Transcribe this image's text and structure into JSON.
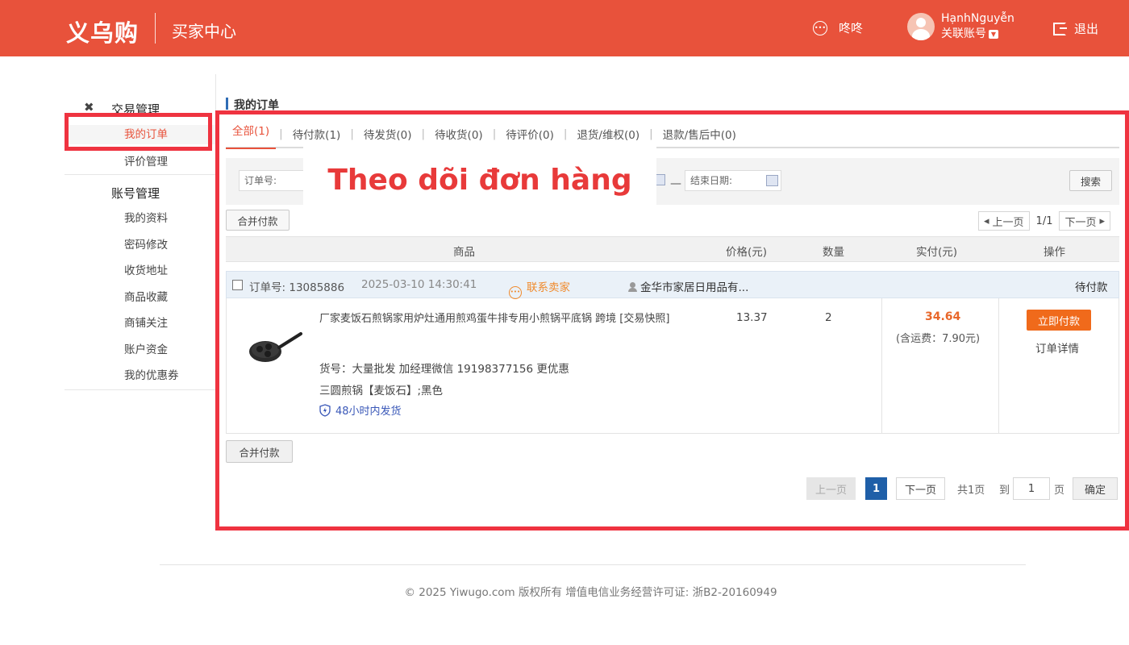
{
  "header": {
    "logo": "义乌购",
    "subtitle": "买家中心",
    "chat_label": "咚咚",
    "user_name": "HạnhNguyễn",
    "linked_account": "关联账号",
    "logout_label": "退出"
  },
  "sidebar": {
    "group_trade": "交易管理",
    "items_trade": [
      {
        "label": "我的订单"
      },
      {
        "label": "评价管理"
      }
    ],
    "group_account": "账号管理",
    "items_account": [
      {
        "label": "我的资料"
      },
      {
        "label": "密码修改"
      },
      {
        "label": "收货地址"
      },
      {
        "label": "商品收藏"
      },
      {
        "label": "商铺关注"
      },
      {
        "label": "账户资金"
      },
      {
        "label": "我的优惠券"
      }
    ]
  },
  "main": {
    "title": "我的订单",
    "tabs": [
      {
        "label": "全部(1)"
      },
      {
        "label": "待付款(1)"
      },
      {
        "label": "待发货(0)"
      },
      {
        "label": "待收货(0)"
      },
      {
        "label": "待评价(0)"
      },
      {
        "label": "退货/维权(0)"
      },
      {
        "label": "退款/售后中(0)"
      }
    ],
    "filter": {
      "order_no_label": "订单号:",
      "end_date_label": "结束日期:",
      "dash": "—",
      "search_label": "搜索"
    },
    "merge_pay_label": "合并付款",
    "pager_top": {
      "prev": "上一页",
      "page_info": "1/1",
      "next": "下一页"
    },
    "table_headers": {
      "product": "商品",
      "price": "价格(元)",
      "quantity": "数量",
      "paid": "实付(元)",
      "action": "操作"
    },
    "order": {
      "order_no_label": "订单号:",
      "order_no": "13085886",
      "datetime": "2025-03-10 14:30:41",
      "contact_seller": "联系卖家",
      "shop_name": "金华市家居日用品有...",
      "status": "待付款",
      "product_title": "厂家麦饭石煎锅家用炉灶通用煎鸡蛋牛排专用小煎锅平底锅 跨境 [交易快照]",
      "sku_note": "货号：大量批发 加经理微信 19198377156 更优惠",
      "variant": "三圆煎锅【麦饭石】;黑色",
      "shipping_badge": "48小时内发货",
      "price": "13.37",
      "quantity": "2",
      "paid_amount": "34.64",
      "shipping_fee": "(含运费：7.90元)",
      "pay_now": "立即付款",
      "order_detail": "订单详情"
    },
    "pager_bottom": {
      "prev": "上一页",
      "current": "1",
      "next": "下一页",
      "total": "共1页",
      "goto": "到",
      "page_value": "1",
      "page_unit": "页",
      "confirm": "确定"
    }
  },
  "footer": {
    "copyright": "© 2025 Yiwugo.com 版权所有 增值电信业务经营许可证: 浙B2-20160949"
  },
  "annotation": {
    "label": "Theo dõi đơn hàng",
    "color": "#ef3340"
  },
  "colors": {
    "brand": "#e8523b",
    "accent_orange": "#f06a1b",
    "link_blue": "#3a58b8"
  }
}
